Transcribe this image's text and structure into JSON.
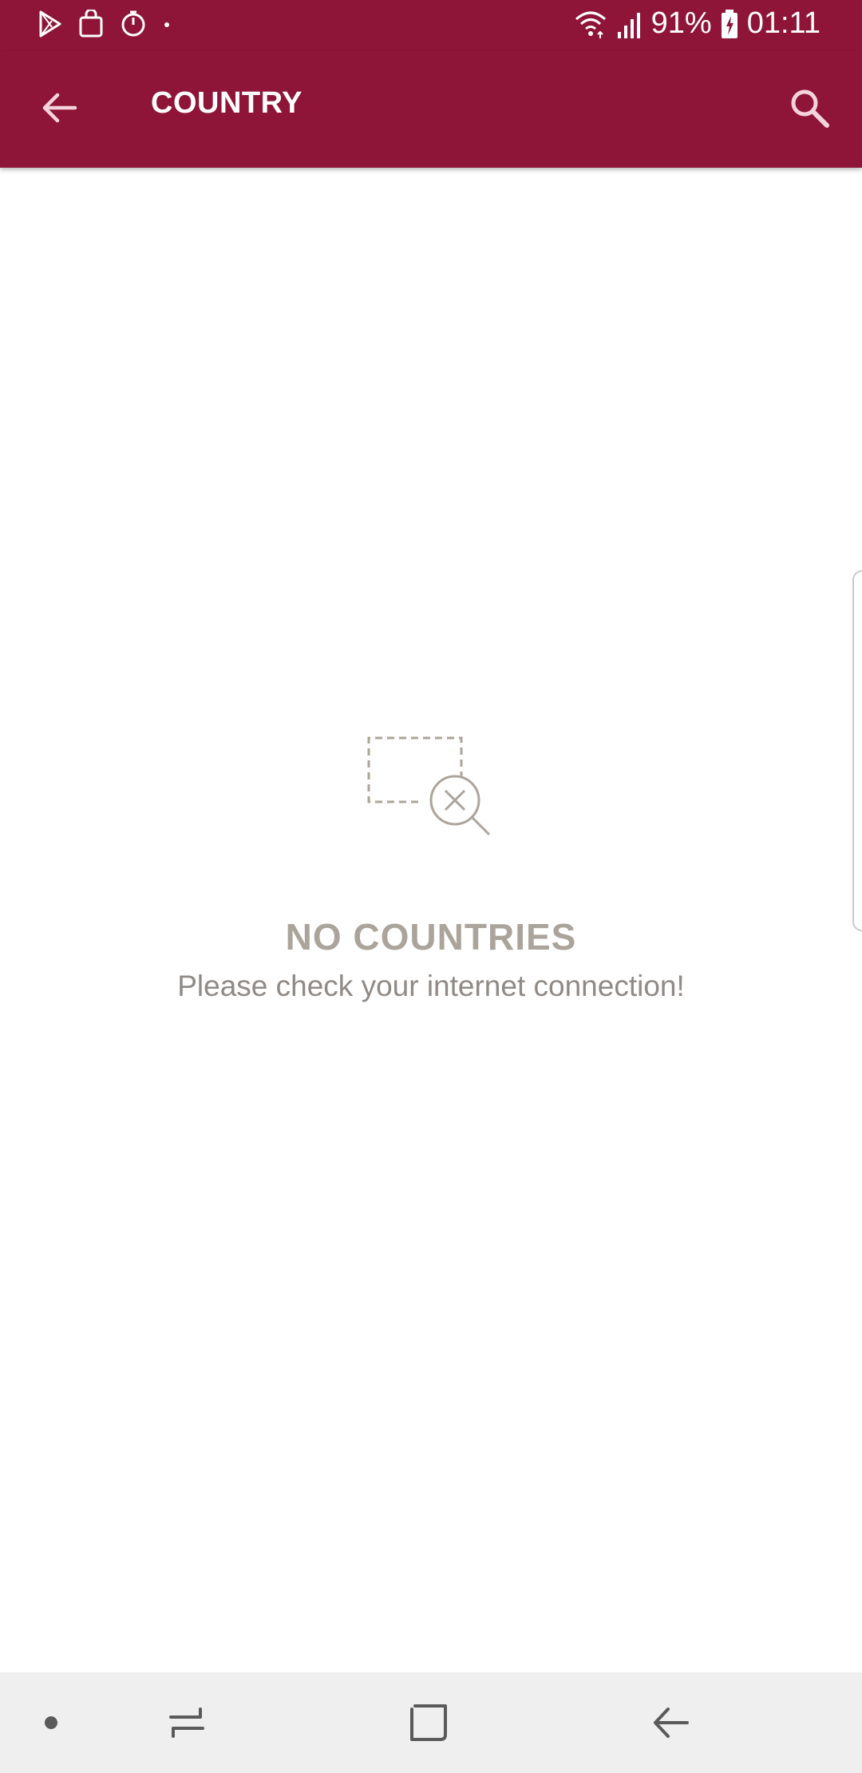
{
  "status_bar": {
    "battery_percent": "91%",
    "time": "01:11",
    "left_icons": [
      "play-store-icon",
      "shopping-bag-icon",
      "timer-icon",
      "dot-icon"
    ],
    "right_icons": [
      "wifi-icon",
      "signal-icon",
      "battery-charging-icon"
    ]
  },
  "app_bar": {
    "title": "COUNTRY",
    "back_icon": "arrow-left-icon",
    "search_icon": "search-icon"
  },
  "empty_state": {
    "illustration": "no-results-icon",
    "title": "NO COUNTRIES",
    "message": "Please check your internet connection!"
  },
  "nav_bar": {
    "items": [
      "nav-dot-icon",
      "recent-apps-icon",
      "home-icon",
      "back-icon"
    ]
  },
  "colors": {
    "brand": "#8e1537",
    "empty_title": "#aba49b",
    "empty_text": "#8f8a86",
    "nav_background": "#efefef"
  }
}
